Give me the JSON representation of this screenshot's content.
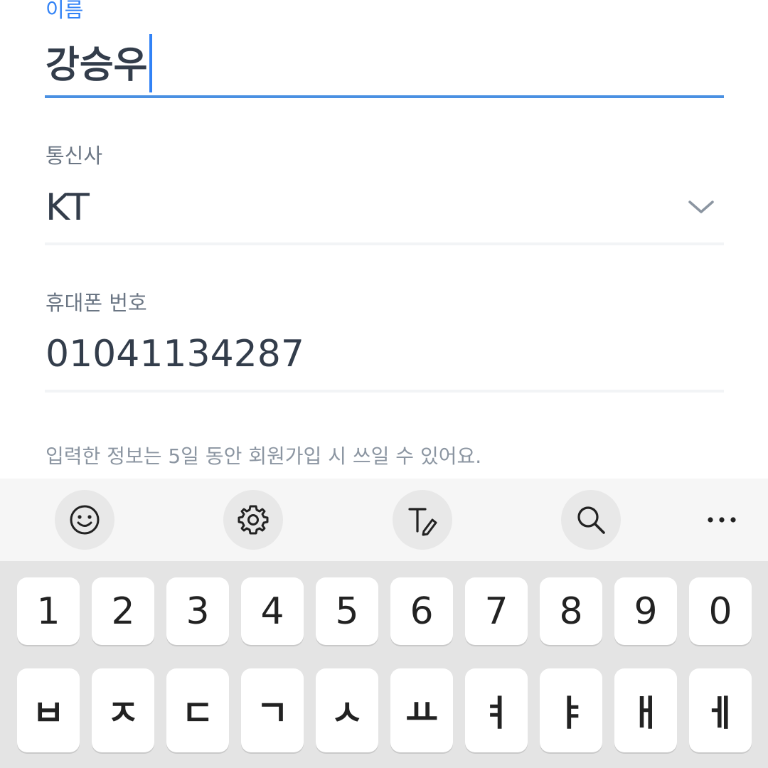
{
  "form": {
    "name": {
      "label": "이름",
      "value": "강승우"
    },
    "carrier": {
      "label": "통신사",
      "value": "KT"
    },
    "phone": {
      "label": "휴대폰 번호",
      "value": "01041134287"
    },
    "notice": "입력한 정보는 5일 동안 회원가입 시 쓰일 수 있어요."
  },
  "toolbar": {
    "items": [
      "emoji-icon",
      "settings-icon",
      "handwriting-icon",
      "search-icon",
      "more-icon"
    ]
  },
  "keyboard": {
    "number_row": [
      "1",
      "2",
      "3",
      "4",
      "5",
      "6",
      "7",
      "8",
      "9",
      "0"
    ],
    "letter_row": [
      "ㅂ",
      "ㅈ",
      "ㄷ",
      "ㄱ",
      "ㅅ",
      "ㅛ",
      "ㅕ",
      "ㅑ",
      "ㅐ",
      "ㅔ"
    ]
  },
  "colors": {
    "accent": "#3182f6",
    "text_primary": "#333d4b",
    "text_secondary": "#6b7684",
    "keyboard_bg": "#e4e4e4"
  }
}
